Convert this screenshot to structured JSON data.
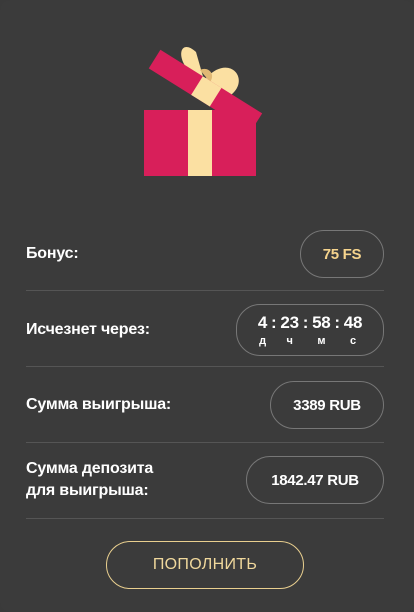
{
  "bonus": {
    "label": "Бонус:",
    "value": "75 FS"
  },
  "expires": {
    "label": "Исчезнет через:",
    "units": [
      {
        "value": "4",
        "unit": "д"
      },
      {
        "value": "23",
        "unit": "ч"
      },
      {
        "value": "58",
        "unit": "м"
      },
      {
        "value": "48",
        "unit": "с"
      }
    ]
  },
  "win_amount": {
    "label": "Сумма выигрыша:",
    "value": "3389 RUB"
  },
  "deposit_amount": {
    "label_line1": "Сумма депозита",
    "label_line2": "для выигрыша:",
    "value": "1842.47 RUB"
  },
  "actions": {
    "deposit_button": "ПОПОЛНИТЬ"
  },
  "colors": {
    "accent": "#f6d48d",
    "gift_box": "#d81f5a",
    "gift_ribbon": "#fbe0a2",
    "background": "#3b3b3b"
  },
  "icons": {
    "hero": "gift-box-icon"
  }
}
